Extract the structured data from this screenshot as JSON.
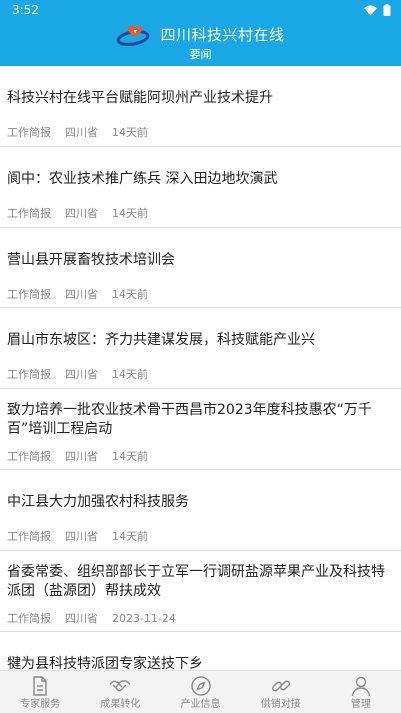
{
  "status_bar": {
    "time": "3:52"
  },
  "header": {
    "title": "四川科技兴村在线",
    "subtitle": "要闻"
  },
  "news": [
    {
      "title": "科技兴村在线平台赋能阿坝州产业技术提升",
      "category": "工作简报",
      "region": "四川省",
      "date": "14天前"
    },
    {
      "title": "阆中：农业技术推广练兵  深入田边地坎演武",
      "category": "工作简报",
      "region": "四川省",
      "date": "14天前"
    },
    {
      "title": "营山县开展畜牧技术培训会",
      "category": "工作简报",
      "region": "四川省",
      "date": "14天前"
    },
    {
      "title": "眉山市东坡区：齐力共建谋发展，科技赋能产业兴",
      "category": "工作简报",
      "region": "四川省",
      "date": "14天前"
    },
    {
      "title": "致力培养一批农业技术骨干西昌市2023年度科技惠农“万千百”培训工程启动",
      "category": "工作简报",
      "region": "四川省",
      "date": "14天前"
    },
    {
      "title": "中江县大力加强农村科技服务",
      "category": "工作简报",
      "region": "四川省",
      "date": "14天前"
    },
    {
      "title": "省委常委、组织部部长于立军一行调研盐源苹果产业及科技特派团（盐源团）帮扶成效",
      "category": "工作简报",
      "region": "四川省",
      "date": "2023-11-24"
    },
    {
      "title": "犍为县科技特派团专家送技下乡",
      "category": "",
      "region": "",
      "date": ""
    }
  ],
  "bottom_nav": [
    {
      "label": "专家服务",
      "icon": "document-icon"
    },
    {
      "label": "成果转化",
      "icon": "handshake-icon"
    },
    {
      "label": "产业信息",
      "icon": "compass-icon"
    },
    {
      "label": "供销对接",
      "icon": "link-icon"
    },
    {
      "label": "管理",
      "icon": "user-icon"
    }
  ],
  "colors": {
    "primary": "#1aa7e6",
    "nav_bg": "#f4f4f4",
    "meta_text": "#8a8a8a"
  }
}
